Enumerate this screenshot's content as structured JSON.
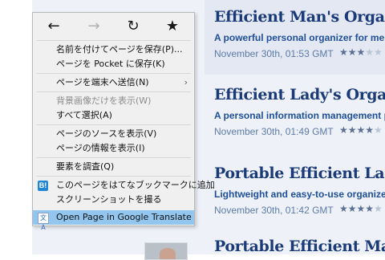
{
  "menu": {
    "nav": {
      "back": "←",
      "forward": "→",
      "reload": "↻",
      "bookmark": "★"
    },
    "items": [
      {
        "label": "名前を付けてページを保存(P)..."
      },
      {
        "label": "ページを Pocket に保存(K)"
      },
      {
        "label": "ページを端末へ送信(N)",
        "submenu_arrow": "›"
      },
      {
        "label": "背景画像だけを表示(W)"
      },
      {
        "label": "すべて選択(A)"
      },
      {
        "label": "ページのソースを表示(V)"
      },
      {
        "label": "ページの情報を表示(I)"
      },
      {
        "label": "要素を調査(Q)"
      },
      {
        "label": "このページをはてなブックマークに追加",
        "icon": "B!"
      },
      {
        "label": "スクリーンショットを撮る"
      },
      {
        "label": "Open Page in Google Translate",
        "icon": "文A"
      }
    ]
  },
  "entries": [
    {
      "title": "Efficient Man's Organizer",
      "desc": "A powerful personal organizer for men that helps",
      "date": "November 30th, 01:53 GMT",
      "rating": 3
    },
    {
      "title": "Efficient Lady's Organizer",
      "desc": "A personal information management package s",
      "date": "November 30th, 01:49 GMT",
      "rating": 4
    },
    {
      "title": "Portable Efficient Lady's",
      "desc": "Lightweight and easy-to-use organizer that ena",
      "date": "November 30th, 01:42 GMT",
      "rating": 4
    },
    {
      "title": "Portable Efficient Man's"
    }
  ],
  "colors": {
    "highlight": "#93c6ee",
    "title_blue": "#1b3a78",
    "desc_blue": "#1f4f9a"
  }
}
